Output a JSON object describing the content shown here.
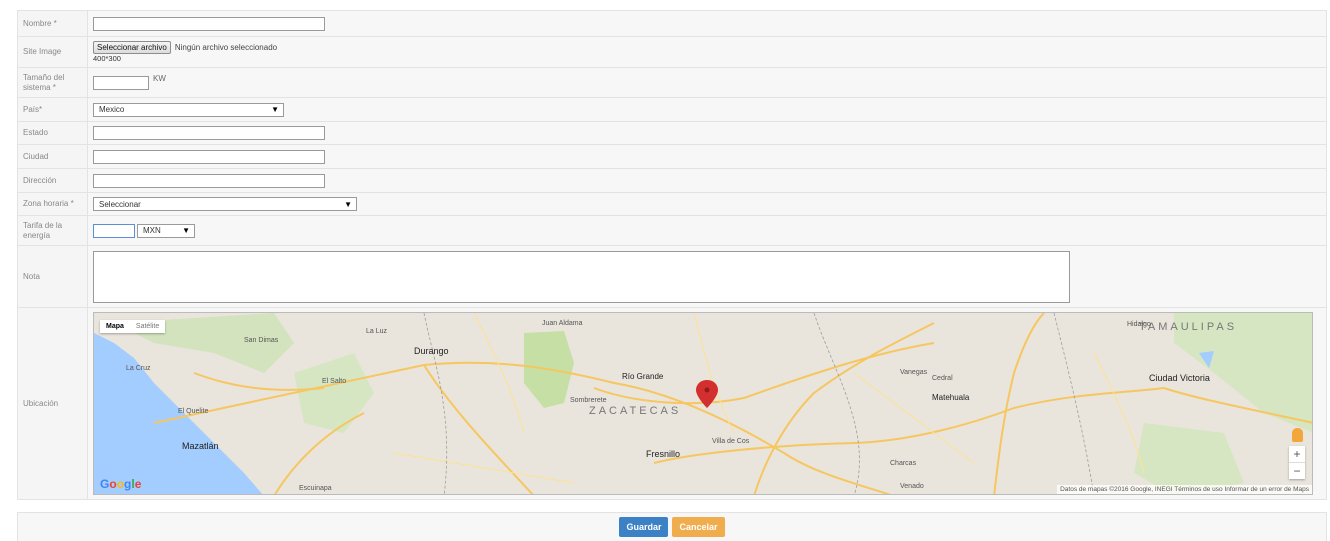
{
  "form": {
    "nombre": {
      "label": "Nombre *",
      "value": ""
    },
    "site_image": {
      "label": "Site Image",
      "button": "Seleccionar archivo",
      "file_status": "Ningún archivo seleccionado",
      "hint": "400*300"
    },
    "tamano": {
      "label": "Tamaño del sistema *",
      "value": "",
      "unit": "KW"
    },
    "pais": {
      "label": "País*",
      "selected": "Mexico"
    },
    "estado": {
      "label": "Estado",
      "value": ""
    },
    "ciudad": {
      "label": "Ciudad",
      "value": ""
    },
    "direccion": {
      "label": "Dirección",
      "value": ""
    },
    "zona_horaria": {
      "label": "Zona horaria *",
      "selected": "Seleccionar"
    },
    "tarifa": {
      "label": "Tarifa de la energía",
      "value": "",
      "currency": "MXN"
    },
    "nota": {
      "label": "Nota",
      "value": ""
    },
    "ubicacion": {
      "label": "Ubicación"
    }
  },
  "map": {
    "type_buttons": [
      "Mapa",
      "Satélite"
    ],
    "labels": {
      "state_zac": "ZACATECAS",
      "state_tam": "TAMAULIPAS",
      "durango": "Durango",
      "mazatlan": "Mazatlán",
      "fresnillo": "Fresnillo",
      "rio_grande": "Río Grande",
      "matehuala": "Matehuala",
      "ciudad_victoria": "Ciudad Victoria",
      "juan_aldama": "Juan Aldama",
      "sombrerete": "Sombrerete",
      "la_luz": "La Luz",
      "san_dimas": "San Dimas",
      "el_salto": "El Salto",
      "vanegas": "Vanegas",
      "cedral": "Cedral",
      "villa_de_cos": "Villa de Cos",
      "charcas": "Charcas",
      "la_cruz": "La Cruz",
      "el_quelite": "El Quelite",
      "escuinapa": "Escuinapa",
      "venado": "Venado",
      "hidalgo": "Hidalgo"
    },
    "logo": "Google",
    "copyright": "Datos de mapas ©2016 Google, INEGI   Términos de uso   Informar de un error de Maps",
    "zoom_in": "+",
    "zoom_out": "−"
  },
  "actions": {
    "save": "Guardar",
    "cancel": "Cancelar"
  },
  "colors": {
    "primary": "#3c80c6",
    "warning": "#f0ad4e",
    "pin": "#d32f2f"
  }
}
